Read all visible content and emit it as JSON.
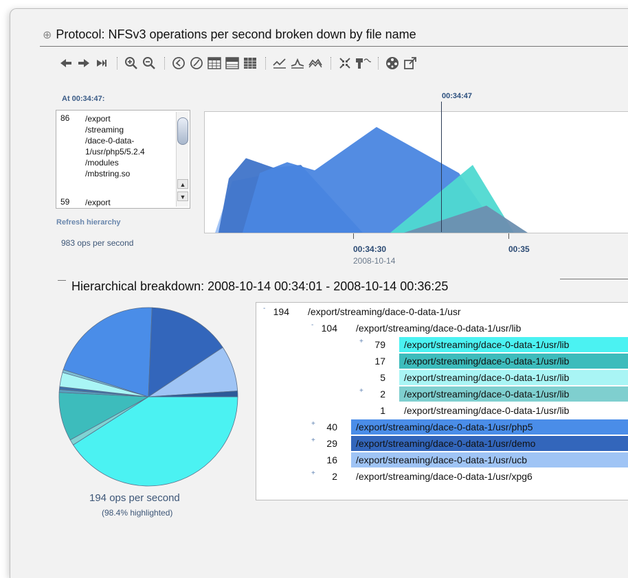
{
  "header": {
    "title": "Protocol: NFSv3 operations per second broken down by file name"
  },
  "toolbar": {
    "icons": [
      "back-icon",
      "forward-icon",
      "skip-end-icon",
      "zoom-in-icon",
      "zoom-out-icon",
      "clock-back-icon",
      "clock-forward-icon",
      "table-icon",
      "table-compact-icon",
      "table-full-icon",
      "line-chart-icon",
      "line-peak-icon",
      "area-chart-icon",
      "collapse-icon",
      "drill-down-icon",
      "palette-icon",
      "export-icon"
    ]
  },
  "left_panel": {
    "at_label": "At 00:34:47:",
    "file_rows": [
      {
        "count": "86",
        "path": "/export\n/streaming\n/dace-0-data-\n1/usr/php5/5.2.4\n/modules\n/mbstring.so"
      },
      {
        "count": "59",
        "path": "/export"
      }
    ],
    "refresh": "Refresh hierarchy",
    "ops": "983 ops per second"
  },
  "chart_data": {
    "type": "area",
    "title": "",
    "marker_label": "00:34:47",
    "x_ticks": [
      {
        "label": "00:34:30",
        "sublabel": "2008-10-14"
      },
      {
        "label": "00:35",
        "sublabel": ""
      }
    ],
    "series": [
      {
        "color": "#9fc2f5",
        "values": [
          0,
          0,
          38,
          42,
          40,
          0,
          0
        ]
      },
      {
        "color": "#3f74c9",
        "values": [
          0,
          40,
          55,
          48,
          50,
          0,
          0
        ]
      },
      {
        "color": "#4a86e0",
        "values": [
          0,
          0,
          44,
          52,
          46,
          78,
          44
        ]
      },
      {
        "color": "#4fd9d1",
        "values": [
          0,
          0,
          0,
          0,
          0,
          0,
          50
        ]
      },
      {
        "color": "#6d8fb0",
        "values": [
          0,
          0,
          0,
          0,
          0,
          0,
          20
        ]
      }
    ]
  },
  "section": {
    "title": "Hierarchical breakdown: 2008-10-14 00:34:01 - 2008-10-14 00:36:25"
  },
  "pie": {
    "ops": "194 ops per second",
    "pct": "(98.4% highlighted)",
    "slices": [
      {
        "value": 79,
        "color": "#4bf2f2"
      },
      {
        "value": 2,
        "color": "#7fd3d3"
      },
      {
        "value": 17,
        "color": "#3dbcbc"
      },
      {
        "value": 1,
        "color": "#5aa0c0"
      },
      {
        "value": 1,
        "color": "#3d6fa8"
      },
      {
        "value": 5,
        "color": "#a9f5f5"
      },
      {
        "value": 1,
        "color": "#7fbfd5"
      },
      {
        "value": 40,
        "color": "#4a8de8"
      },
      {
        "value": 29,
        "color": "#3366bb"
      },
      {
        "value": 16,
        "color": "#9fc4f5"
      },
      {
        "value": 2,
        "color": "#2d5a98"
      }
    ]
  },
  "tree": {
    "rows": [
      {
        "toggle": "-",
        "count": "194",
        "path": "/export/streaming/dace-0-data-1/usr",
        "level": 0,
        "bg": ""
      },
      {
        "toggle": "-",
        "count": "104",
        "path": "/export/streaming/dace-0-data-1/usr/lib",
        "level": 1,
        "bg": ""
      },
      {
        "toggle": "+",
        "count": "79",
        "path": "/export/streaming/dace-0-data-1/usr/lib",
        "level": 2,
        "bg": "#4bf2f2"
      },
      {
        "toggle": "",
        "count": "17",
        "path": "/export/streaming/dace-0-data-1/usr/lib",
        "level": 2,
        "bg": "#3dbcbc"
      },
      {
        "toggle": "",
        "count": "5",
        "path": "/export/streaming/dace-0-data-1/usr/lib",
        "level": 2,
        "bg": "#a9f5f5"
      },
      {
        "toggle": "+",
        "count": "2",
        "path": "/export/streaming/dace-0-data-1/usr/lib",
        "level": 2,
        "bg": "#7fcfcf"
      },
      {
        "toggle": "",
        "count": "1",
        "path": "/export/streaming/dace-0-data-1/usr/lib",
        "level": 2,
        "bg": ""
      },
      {
        "toggle": "+",
        "count": "40",
        "path": "/export/streaming/dace-0-data-1/usr/php5",
        "level": 1,
        "bg": "#4a8de8"
      },
      {
        "toggle": "+",
        "count": "29",
        "path": "/export/streaming/dace-0-data-1/usr/demo",
        "level": 1,
        "bg": "#3366bb"
      },
      {
        "toggle": "",
        "count": "16",
        "path": "/export/streaming/dace-0-data-1/usr/ucb",
        "level": 1,
        "bg": "#9fc4f5"
      },
      {
        "toggle": "+",
        "count": "2",
        "path": "/export/streaming/dace-0-data-1/usr/xpg6",
        "level": 1,
        "bg": ""
      }
    ]
  }
}
